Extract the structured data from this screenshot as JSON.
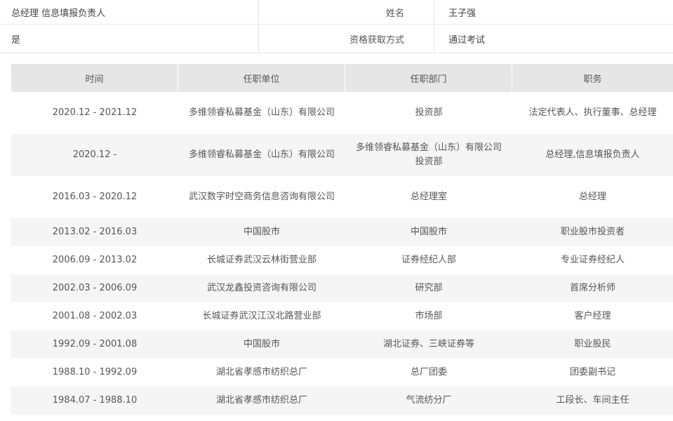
{
  "info": {
    "row1": {
      "left": "总经理 信息填报负责人",
      "label": "姓名",
      "value": "王子强"
    },
    "row2": {
      "left": "是",
      "label": "资格获取方式",
      "value": "通过考试"
    }
  },
  "table": {
    "headers": [
      "时间",
      "任职单位",
      "任职部门",
      "职务"
    ],
    "rows": [
      {
        "time": "2020.12 - 2021.12",
        "unit": "多维领睿私募基金（山东）有限公司",
        "dept": "投资部",
        "post": "法定代表人、执行董事、总经理"
      },
      {
        "time": "2020.12 -",
        "unit": "多维领睿私募基金（山东）有限公司",
        "dept": "多维领睿私募基金（山东）有限公司投资部",
        "post": "总经理,信息填报负责人"
      },
      {
        "time": "2016.03 - 2020.12",
        "unit": "武汉数字时空商务信息咨询有限公司",
        "dept": "总经理室",
        "post": "总经理"
      },
      {
        "time": "2013.02 - 2016.03",
        "unit": "中国股市",
        "dept": "中国股市",
        "post": "职业股市投资者"
      },
      {
        "time": "2006.09 - 2013.02",
        "unit": "长城证券武汉云林街营业部",
        "dept": "证券经纪人部",
        "post": "专业证券经纪人"
      },
      {
        "time": "2002.03 - 2006.09",
        "unit": "武汉龙鑫投资咨询有限公司",
        "dept": "研究部",
        "post": "首席分析师"
      },
      {
        "time": "2001.08 - 2002.03",
        "unit": "长城证券武汉江汉北路营业部",
        "dept": "市场部",
        "post": "客户经理"
      },
      {
        "time": "1992.09 - 2001.08",
        "unit": "中国股市",
        "dept": "湖北证券、三峡证券等",
        "post": "职业股民"
      },
      {
        "time": "1988.10 - 1992.09",
        "unit": "湖北省孝感市纺织总厂",
        "dept": "总厂团委",
        "post": "团委副书记"
      },
      {
        "time": "1984.07 - 1988.10",
        "unit": "湖北省孝感市纺织总厂",
        "dept": "气流纺分厂",
        "post": "工段长、车间主任"
      }
    ]
  }
}
